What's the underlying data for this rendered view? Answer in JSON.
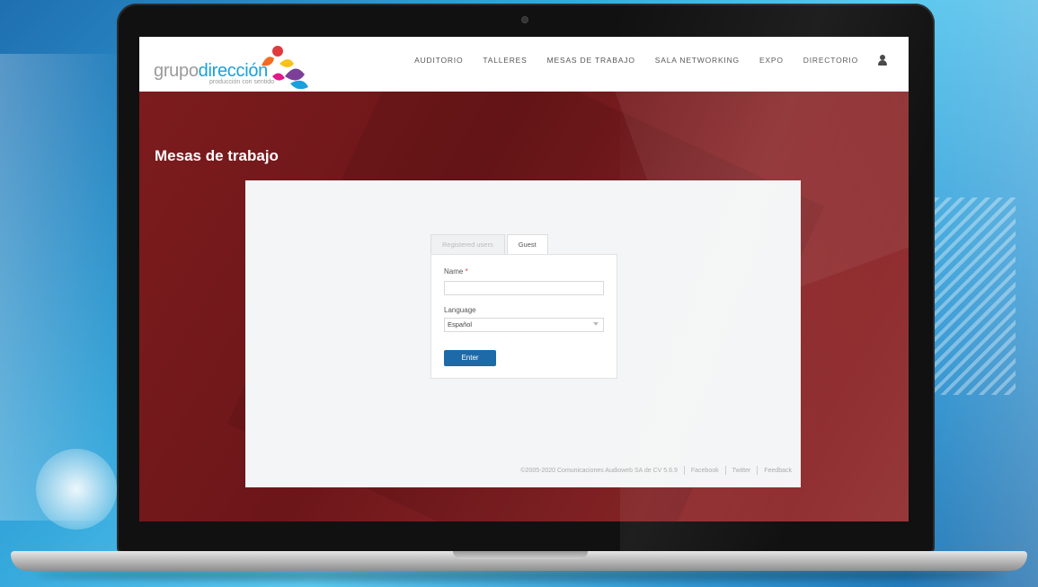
{
  "brand": {
    "logo_part1": "grupo",
    "logo_part2": "dirección",
    "tagline": "producción con sentido"
  },
  "nav": {
    "items": [
      "AUDITORIO",
      "TALLERES",
      "MESAS DE TRABAJO",
      "SALA NETWORKING",
      "EXPO",
      "DIRECTORIO"
    ],
    "user_icon": "user-icon"
  },
  "page": {
    "title": "Mesas de trabajo"
  },
  "login": {
    "tabs": [
      {
        "label": "Registered users",
        "active": false
      },
      {
        "label": "Guest",
        "active": true
      }
    ],
    "name_label": "Name",
    "required_mark": "*",
    "name_value": "",
    "language_label": "Language",
    "language_value": "Español",
    "enter_label": "Enter"
  },
  "footer": {
    "copyright": "©2005-2020 Comunicaciones Audioweb SA de CV 5.6.9",
    "links": [
      "Facebook",
      "Twitter",
      "Feedback"
    ]
  },
  "colors": {
    "brand_blue": "#1aa0dd",
    "page_bg": "#7e1c1e",
    "button": "#1e6aa8"
  }
}
